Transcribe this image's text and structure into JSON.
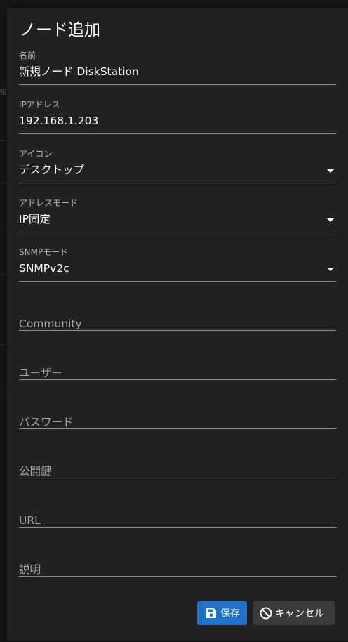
{
  "dialog": {
    "title": "ノード追加"
  },
  "fields": {
    "name": {
      "label": "名前",
      "value": "新規ノード DiskStation"
    },
    "ip": {
      "label": "IPアドレス",
      "value": "192.168.1.203"
    },
    "icon": {
      "label": "アイコン",
      "value": "デスクトップ",
      "icon": "chevron-down-icon"
    },
    "address_mode": {
      "label": "アドレスモード",
      "value": "IP固定",
      "icon": "chevron-down-icon"
    },
    "snmp_mode": {
      "label": "SNMPモード",
      "value": "SNMPv2c",
      "icon": "chevron-down-icon"
    },
    "community": {
      "placeholder": "Community"
    },
    "user": {
      "placeholder": "ユーザー"
    },
    "password": {
      "placeholder": "パスワード"
    },
    "public_key": {
      "placeholder": "公開鍵"
    },
    "url": {
      "placeholder": "URL"
    },
    "description": {
      "placeholder": "説明"
    }
  },
  "buttons": {
    "save": {
      "label": "保存",
      "icon": "floppy-disk-icon"
    },
    "cancel": {
      "label": "キャンセル",
      "icon": "block-icon"
    }
  },
  "background": {
    "glyph": "指"
  },
  "colors": {
    "dialog_bg": "#212121",
    "primary": "#1e72c8",
    "cancel_bg": "#3a3a3a",
    "underline": "#8e8e8e"
  }
}
